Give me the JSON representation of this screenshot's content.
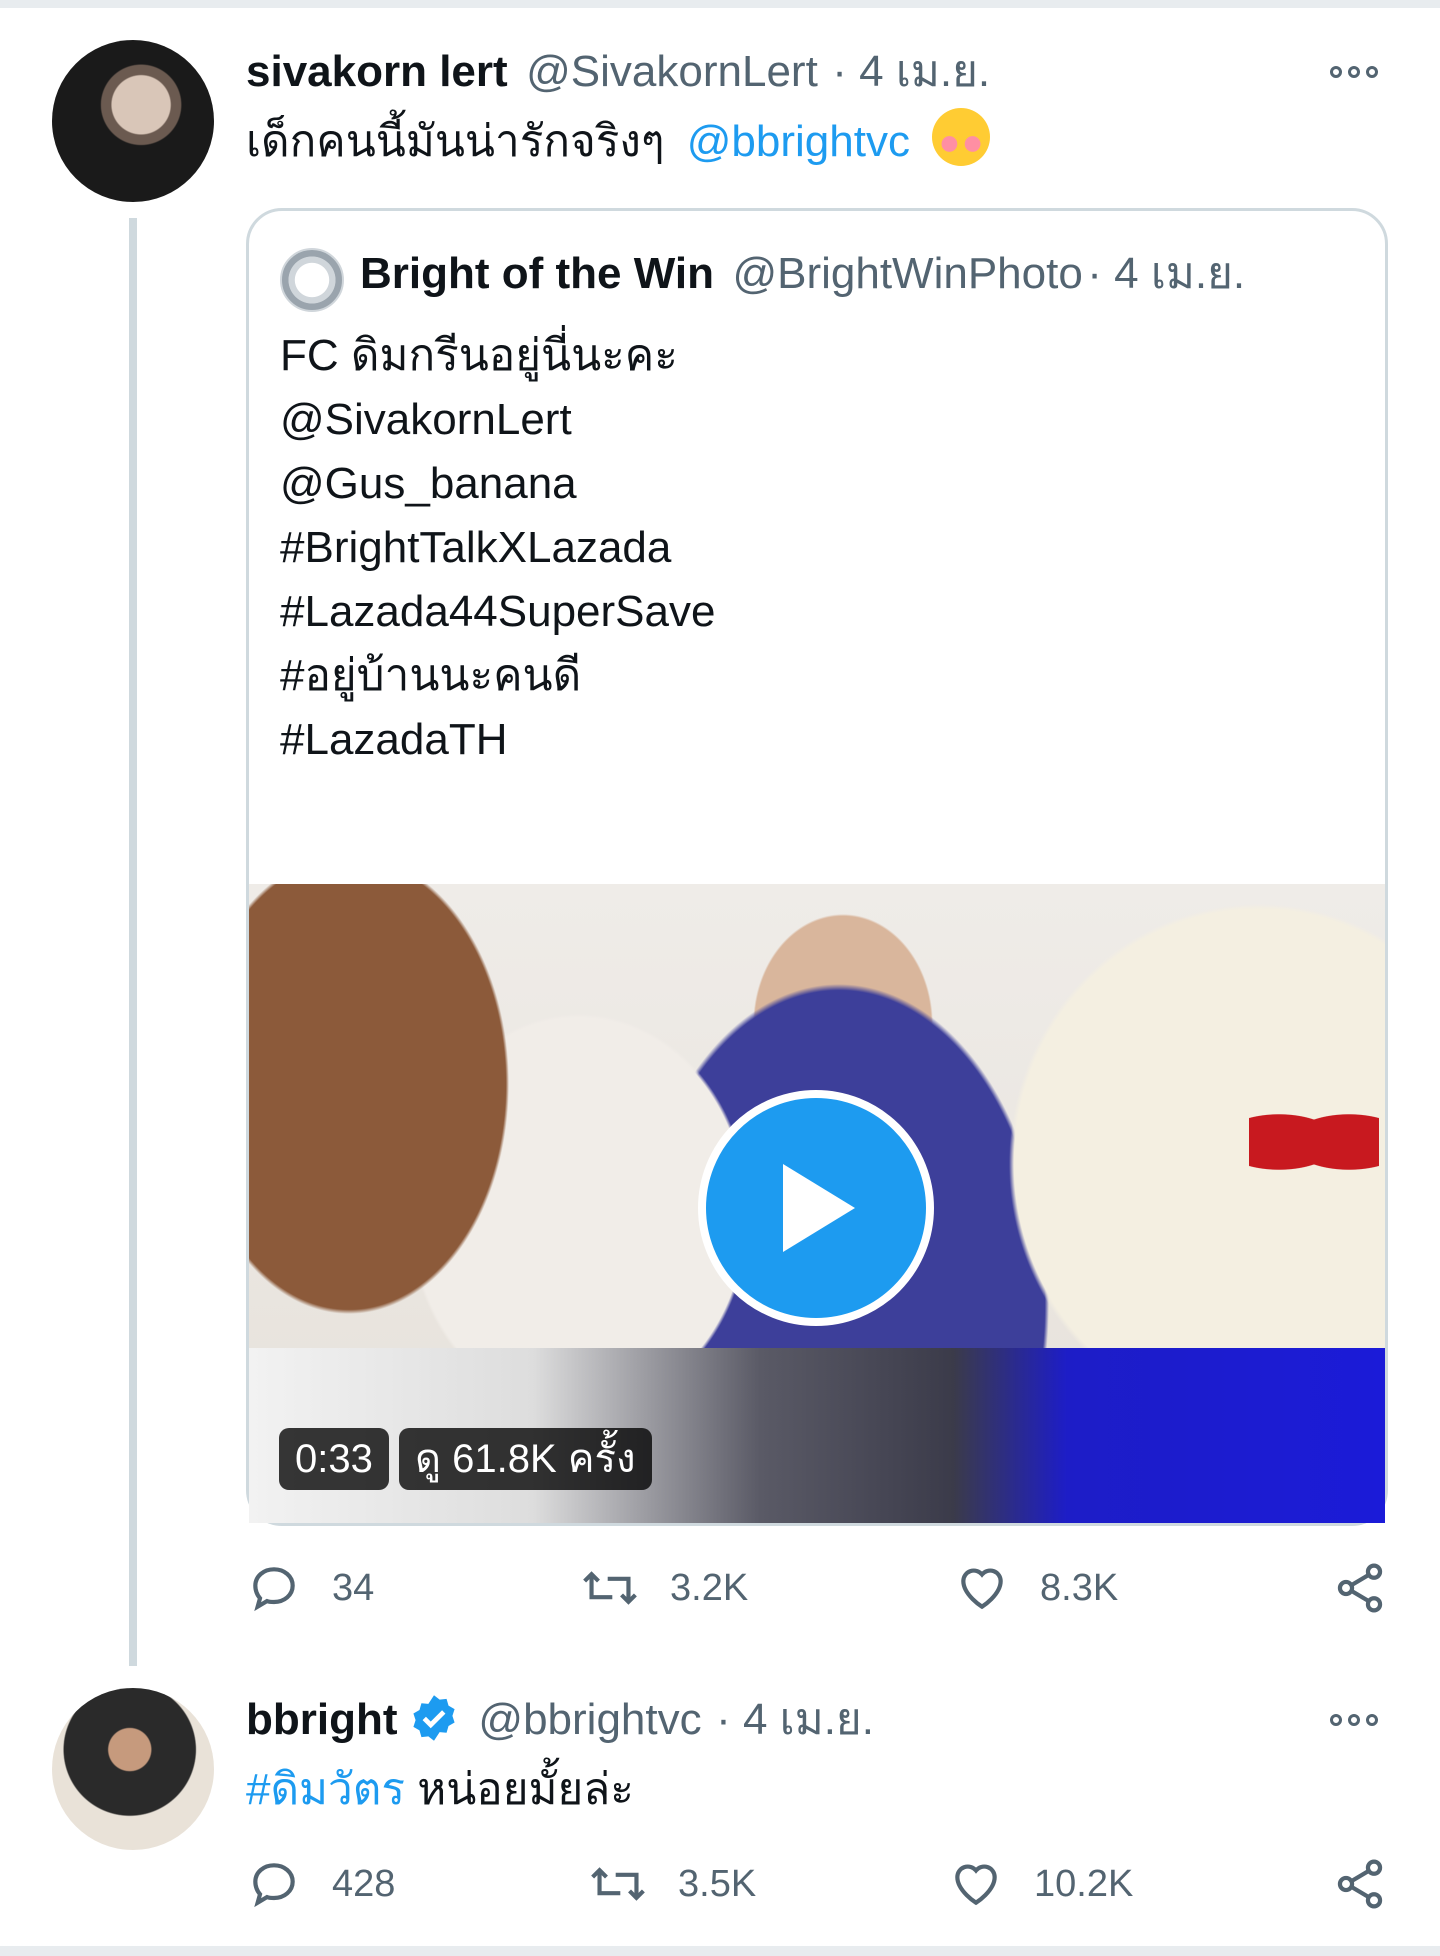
{
  "tweet1": {
    "name": "sivakorn lert",
    "handle": "@SivakornLert",
    "date": "· 4 เม.ย.",
    "text": "เด็กคนนี้มันน่ารักจริงๆ",
    "mention": "@bbrightvc",
    "emoji": "☺",
    "counts": {
      "reply": "34",
      "retweet": "3.2K",
      "like": "8.3K"
    }
  },
  "quote": {
    "name": "Bright of the Win",
    "handle": "@BrightWinPhoto",
    "date": "· 4 เม.ย.",
    "lines": [
      "FC ดิมกรีนอยู่นี่นะคะ",
      "@SivakornLert",
      "@Gus_banana",
      "#BrightTalkXLazada",
      "",
      "#Lazada44SuperSave",
      "#อยู่บ้านนะคนดี",
      "#LazadaTH"
    ],
    "video": {
      "duration": "0:33",
      "views": "ดู 61.8K ครั้ง"
    }
  },
  "tweet2": {
    "name": "bbright",
    "handle": "@bbrightvc",
    "date": "· 4 เม.ย.",
    "hashtag": "#ดิมวัตร",
    "text": " หน่อยมั้ยล่ะ",
    "counts": {
      "reply": "428",
      "retweet": "3.5K",
      "like": "10.2K"
    }
  },
  "colors": {
    "accent": "#1d9bf0",
    "muted": "#536471",
    "border": "#cfd9de"
  }
}
